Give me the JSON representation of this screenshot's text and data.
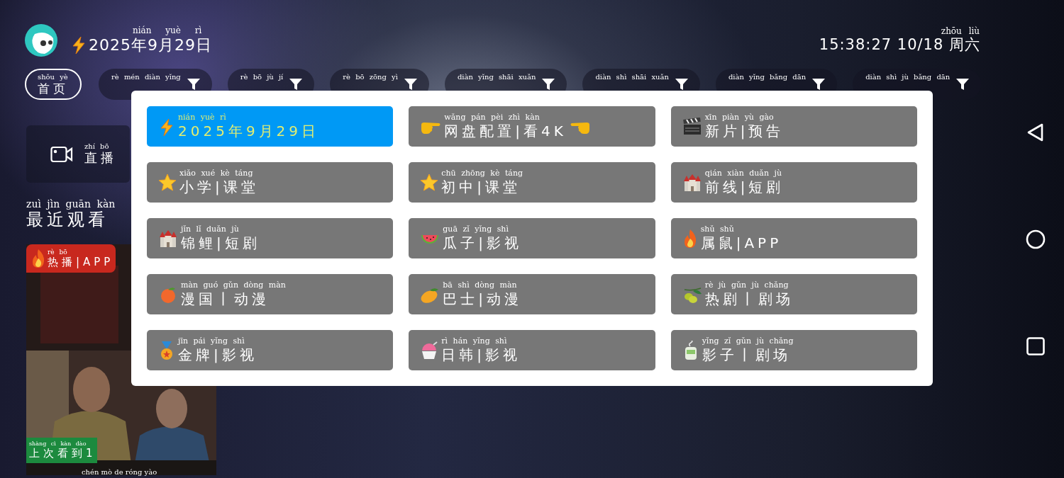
{
  "header": {
    "date": {
      "text": "2025年9月29日",
      "pinyin": "nián yuè rì"
    },
    "clock": {
      "text": "15:38:27 10/18 周六",
      "pinyin": "zhōu liù"
    }
  },
  "tabs": [
    {
      "text": "首页",
      "pinyin": "shǒu yè",
      "selected": true,
      "filter": false
    },
    {
      "pinyin": "rè mén diàn yǐng",
      "selected": false,
      "filter": true
    },
    {
      "pinyin": "rè bō jù jí",
      "selected": false,
      "filter": true
    },
    {
      "pinyin": "rè bō zōng yì",
      "selected": false,
      "filter": true
    },
    {
      "pinyin": "diàn yǐng shāi xuǎn",
      "selected": false,
      "filter": true
    },
    {
      "pinyin": "diàn shì shāi xuǎn",
      "selected": false,
      "filter": true
    },
    {
      "pinyin": "diàn yǐng bǎng dān",
      "selected": false,
      "filter": true
    },
    {
      "pinyin": "diàn shì jù bǎng dān",
      "selected": false,
      "filter": true
    }
  ],
  "live": {
    "text": "直播",
    "pinyin": "zhí bō"
  },
  "recent": {
    "text": "最近观看",
    "pinyin": "zuì jìn guān kàn"
  },
  "poster": {
    "badge": {
      "text": "热播|APP",
      "pinyin": "rè bō"
    },
    "progress": {
      "text": "上次看到1",
      "pinyin": "shàng cì kàn dào"
    },
    "title_pinyin": "chén mò de róng yào"
  },
  "dialog": {
    "items": [
      {
        "text": "2025年9月29日",
        "pinyin": "nián yuè rì",
        "selected": true
      },
      {
        "text": "网盘配置|看4K",
        "pinyin": "wǎng pán pèi zhì kàn",
        "selected": false
      },
      {
        "text": "新片|预告",
        "pinyin": "xīn piàn yù gào",
        "selected": false
      },
      {
        "text": "小学|课堂",
        "pinyin": "xiǎo xué kè táng",
        "selected": false
      },
      {
        "text": "初中|课堂",
        "pinyin": "chū zhōng kè táng",
        "selected": false
      },
      {
        "text": "前线|短剧",
        "pinyin": "qián xiàn duǎn jù",
        "selected": false
      },
      {
        "text": "锦鲤|短剧",
        "pinyin": "jǐn lǐ duǎn jù",
        "selected": false
      },
      {
        "text": "瓜子|影视",
        "pinyin": "guā zǐ yǐng shì",
        "selected": false
      },
      {
        "text": "属鼠|APP",
        "pinyin": "shǔ shǔ",
        "selected": false
      },
      {
        "text": "漫国丨动漫",
        "pinyin": "màn guó gǔn dòng màn",
        "selected": false
      },
      {
        "text": "巴士|动漫",
        "pinyin": "bā shì dòng màn",
        "selected": false
      },
      {
        "text": "热剧丨剧场",
        "pinyin": "rè jù gǔn jù chǎng",
        "selected": false
      },
      {
        "text": "金牌|影视",
        "pinyin": "jīn pái yǐng shì",
        "selected": false
      },
      {
        "text": "日韩|影视",
        "pinyin": "rì hán yǐng shì",
        "selected": false
      },
      {
        "text": "影子丨剧场",
        "pinyin": "yǐng zǐ gǔn jù chǎng",
        "selected": false
      }
    ]
  }
}
